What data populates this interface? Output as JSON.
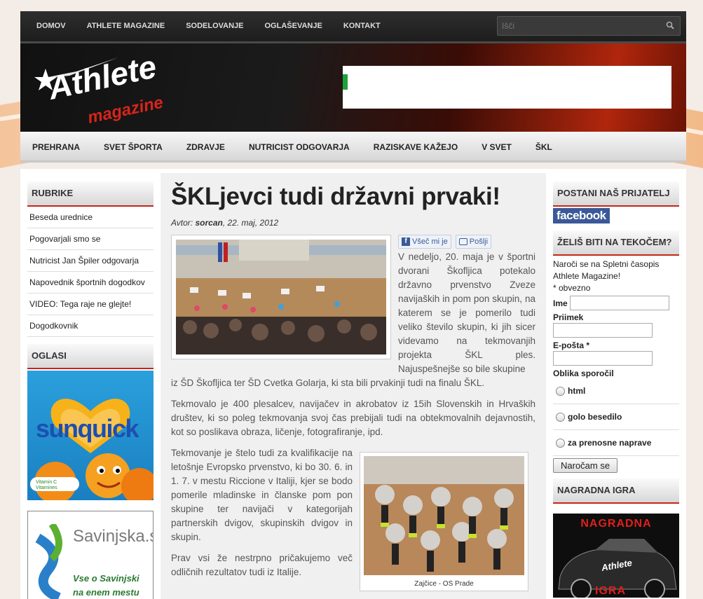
{
  "top_nav": {
    "items": [
      "DOMOV",
      "ATHLETE MAGAZINE",
      "SODELOVANJE",
      "OGLAŠEVANJE",
      "KONTAKT"
    ],
    "search_placeholder": "Išči"
  },
  "logo": {
    "line1": "Athlete",
    "line2": "magazine"
  },
  "main_nav": {
    "items": [
      "PREHRANA",
      "SVET ŠPORTA",
      "ZDRAVJE",
      "NUTRICIST ODGOVARJA",
      "RAZISKAVE KAŽEJO",
      "V SVET",
      "ŠKL"
    ]
  },
  "left": {
    "rubrike_title": "RUBRIKE",
    "rubrike": [
      "Beseda urednice",
      "Pogovarjali smo se",
      "Nutricist Jan Špiler odgovarja",
      "Napovednik športnih dogodkov",
      "VIDEO: Tega raje ne glejte!",
      "Dogodkovnik"
    ],
    "oglasi_title": "OGLASI",
    "ad1": {
      "brand": "sunquick",
      "badge": "Vitamin C",
      "badge_sub": "Vitamines"
    },
    "ad2": {
      "name": "Savinjska.si",
      "slogan1": "Vse o Savinjski",
      "slogan2": "na enem mestu"
    }
  },
  "article": {
    "title": "ŠKLjevci tudi državni prvaki!",
    "author_label": "Avtor:",
    "author": "sorcan",
    "date": ", 22. maj, 2012",
    "like_label": "Všeč mi je",
    "send_label": "Pošlji",
    "p1": "V nedeljo, 20. maja je v športni dvorani Škofljica potekalo državno prvenstvo Zveze navijaških in pom pon skupin, na katerem se je pomerilo tudi veliko število skupin, ki jih sicer videvamo na tekmovanjih projekta ŠKL ples. Najuspešnejše so bile skupine iz ŠD Škofljica ter ŠD Cvetka Golarja, ki sta bili prvakinji tudi na finalu ŠKL.",
    "p2": "Tekmovalo je 400 plesalcev, navijačev in akrobatov iz 15ih Slovenskih in Hrvaških društev, ki so poleg tekmovanja svoj čas prebijali tudi na obtekmovalnih dejavnostih, kot so poslikava obraza, ličenje, fotografiranje, ipd.",
    "p3": "Tekmovanje je štelo tudi za kvalifikacije na letošnje Evropsko prvenstvo, ki bo 30. 6. in 1. 7. v mestu Riccione v Italiji, kjer se bodo pomerile mladinske in članske pom pon skupine ter navijači v kategorijah partnerskih dvigov, skupinskih dvigov in skupin.",
    "p4": "Prav vsi že nestrpno pričakujemo več odličnih rezultatov tudi iz Italije.",
    "caption2": "Zajčice - OS Prade"
  },
  "right": {
    "friend_title": "POSTANI NAŠ PRIJATELJ",
    "facebook": "facebook",
    "news_title": "ŽELIŠ BITI NA TEKOČEM?",
    "news_text": "Naroči se na Spletni časopis Athlete Magazine!",
    "required": "* obvezno",
    "ime": "Ime",
    "priimek": "Priimek",
    "eposta": "E-pošta *",
    "format_label": "Oblika sporočil",
    "formats": [
      "html",
      "golo besedilo",
      "za prenosne naprave"
    ],
    "submit": "Naročam se",
    "prize_title": "NAGRADNA IGRA",
    "prize_text": "NAGRADNA",
    "prize_text2": "IGRA",
    "car_text": "Athlete"
  },
  "colors": {
    "accent": "#c4261a",
    "dark": "#1d1d1d",
    "facebook": "#3b5998"
  }
}
